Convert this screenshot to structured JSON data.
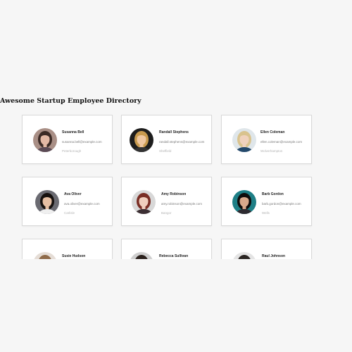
{
  "page_title": "Awesome Startup Employee Directory",
  "employees": [
    {
      "name": "Susanna Bell",
      "email": "susanna.bell@example.com",
      "city": "Peterborough",
      "avatar": "avatar-woman-dark-hair",
      "colors": {
        "bg": "#a98f86",
        "hair": "#3b2a25",
        "skin": "#e2b8a4",
        "shirt": "#5b4a55"
      }
    },
    {
      "name": "Randall Stephens",
      "email": "randall.stephens@example.com",
      "city": "Sheffield",
      "avatar": "avatar-man-blond",
      "colors": {
        "bg": "#1d1d1d",
        "hair": "#c89a4e",
        "skin": "#efc7a0",
        "shirt": "#333333"
      }
    },
    {
      "name": "Ellen Coleman",
      "email": "ellen.coleman@example.com",
      "city": "Wolverhampton",
      "avatar": "avatar-woman-blonde",
      "colors": {
        "bg": "#dfe6ea",
        "hair": "#d9c38e",
        "skin": "#f0d2bd",
        "shirt": "#24496b"
      }
    },
    {
      "name": "Ava Oliver",
      "email": "ava.oliver@example.com",
      "city": "Carlisle",
      "avatar": "avatar-woman-black-hair",
      "colors": {
        "bg": "#6b6b72",
        "hair": "#16110f",
        "skin": "#e6bfa3",
        "shirt": "#efefef"
      }
    },
    {
      "name": "Amy Robinson",
      "email": "amy.robinson@example.com",
      "city": "Bangor",
      "avatar": "avatar-woman-red-hair",
      "colors": {
        "bg": "#d8d8d8",
        "hair": "#7a2e25",
        "skin": "#f0cfbe",
        "shirt": "#3c2f33"
      }
    },
    {
      "name": "Barb Gordon",
      "email": "barb.gordon@example.com",
      "city": "Wells",
      "avatar": "avatar-woman-teal-background",
      "colors": {
        "bg": "#1e7f86",
        "hair": "#0f0c0b",
        "skin": "#d9a98b",
        "shirt": "#2e2a30"
      }
    },
    {
      "name": "Susie Hudson",
      "email": "",
      "city": "",
      "avatar": "avatar-woman-light-brown-hair",
      "colors": {
        "bg": "#e5ddd6",
        "hair": "#8f6b4a",
        "skin": "#efcdb5",
        "shirt": "#b9a99a"
      }
    },
    {
      "name": "Rebecca Sullivan",
      "email": "",
      "city": "",
      "avatar": "avatar-woman-dark-hair-2",
      "colors": {
        "bg": "#cfcfcf",
        "hair": "#2b211d",
        "skin": "#e8c3aa",
        "shirt": "#444444"
      }
    },
    {
      "name": "Raul Johnson",
      "email": "",
      "city": "",
      "avatar": "avatar-man-dark-hair",
      "colors": {
        "bg": "#e4e4e4",
        "hair": "#2a2522",
        "skin": "#d9b39a",
        "shirt": "#555555"
      }
    }
  ]
}
